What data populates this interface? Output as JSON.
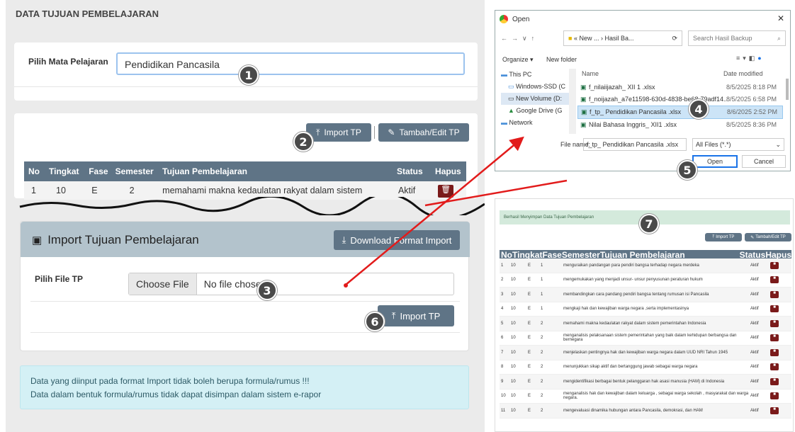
{
  "left": {
    "heading": "DATA TUJUAN PEMBELAJARAN",
    "subject_label": "Pilih Mata Pelajaran",
    "subject_value": "Pendidikan Pancasila",
    "import_button": "Import TP",
    "edit_button": "Tambah/Edit TP",
    "table_headers": [
      "No",
      "Tingkat",
      "Fase",
      "Semester",
      "Tujuan Pembelajaran",
      "Status",
      "Hapus"
    ],
    "table_row": [
      "1",
      "10",
      "E",
      "2",
      "memahami makna kedaulatan rakyat dalam sistem",
      "Aktif"
    ],
    "import_panel_title": "Import Tujuan Pembelajaran",
    "download_button": "Download Format Import",
    "file_label": "Pilih File TP",
    "choose_file": "Choose File",
    "no_file": "No file chosen",
    "import_tp_button": "Import TP",
    "notice_line1": "Data yang diinput pada format Import tidak boleh berupa formula/rumus !!!",
    "notice_line2": "Data dalam bentuk formula/rumus tidak dapat disimpan dalam sistem e-rapor"
  },
  "dialog": {
    "title": "Open",
    "path": "« New ... › Hasil Ba...",
    "search_placeholder": "Search Hasil Backup",
    "organize": "Organize ▾",
    "new_folder": "New folder",
    "nav": [
      "This PC",
      "Windows-SSD (C",
      "New Volume (D:",
      "Google Drive (G",
      "Network"
    ],
    "col_name": "Name",
    "col_date": "Date modified",
    "files": [
      {
        "name": "f_nilaiijazah_ XII 1 .xlsx",
        "date": "8/5/2025 8:18 PM"
      },
      {
        "name": "f_noijazah_a7e11598-630d-4838-be68-79adf14...",
        "date": "8/5/2025 6:58 PM"
      },
      {
        "name": "f_tp_ Pendidikan Pancasila .xlsx",
        "date": "8/6/2025 2:52 PM"
      },
      {
        "name": "Nilai Bahasa Inggris_ XII1 .xlsx",
        "date": "8/5/2025 8:36 PM"
      }
    ],
    "filename_label": "File name:",
    "filename_value": "f_tp_ Pendidikan Pancasila .xlsx",
    "filter": "All Files (*.*)",
    "open_button": "Open",
    "cancel_button": "Cancel"
  },
  "result": {
    "success": "Berhasil Menyimpan Data Tujuan Pembelajaran",
    "import_btn": "Import TP",
    "edit_btn": "Tambah/Edit TP",
    "headers": [
      "No",
      "Tingkat",
      "Fase",
      "Semester",
      "Tujuan Pembelajaran",
      "Status",
      "Hapus"
    ],
    "rows": [
      [
        "1",
        "10",
        "E",
        "1",
        "menguraikan pandangan para pendiri bangsa terhadap negara merdeka",
        "Aktif"
      ],
      [
        "2",
        "10",
        "E",
        "1",
        "mengemukakan yang menjadi unsur- unsur penyusunan peraturan hukum",
        "Aktif"
      ],
      [
        "3",
        "10",
        "E",
        "1",
        "membandingkan cara pandang pendiri bangsa tentang rumusan isi Pancasila",
        "Aktif"
      ],
      [
        "4",
        "10",
        "E",
        "1",
        "mengkaji hak dan kewajiban warga negara ,serta implementasinya",
        "Aktif"
      ],
      [
        "5",
        "10",
        "E",
        "2",
        "memahami makna kedaulatan rakyat dalam sistem pemerintahan Indonesia",
        "Aktif"
      ],
      [
        "6",
        "10",
        "E",
        "2",
        "menganalisis pelaksanaan sistem pemerintahan yang baik dalam kehidupan berbangsa dan bernegara",
        "Aktif"
      ],
      [
        "7",
        "10",
        "E",
        "2",
        "menjelaskan pentingnya hak dan kewajiban warga negara dalam UUD NRI Tahun 1945",
        "Aktif"
      ],
      [
        "8",
        "10",
        "E",
        "2",
        "menunjukkan sikap aktif dan bertanggung jawab sebagai warga negara",
        "Aktif"
      ],
      [
        "9",
        "10",
        "E",
        "2",
        "mengidentifikasi berbagai bentuk pelanggaran hak asasi manusia (HAM) di Indonesia",
        "Aktif"
      ],
      [
        "10",
        "10",
        "E",
        "2",
        "menganalisis hak dan kewajiban dalam keluarga , sebagai warga sekolah , masyarakat dan warga negara.",
        "Aktif"
      ],
      [
        "11",
        "10",
        "E",
        "2",
        "mengevaluasi dinamika hubungan antara Pancasila, demokrasi, dan HAM",
        "Aktif"
      ]
    ]
  },
  "badges": [
    "1",
    "2",
    "3",
    "4",
    "5",
    "6",
    "7"
  ]
}
